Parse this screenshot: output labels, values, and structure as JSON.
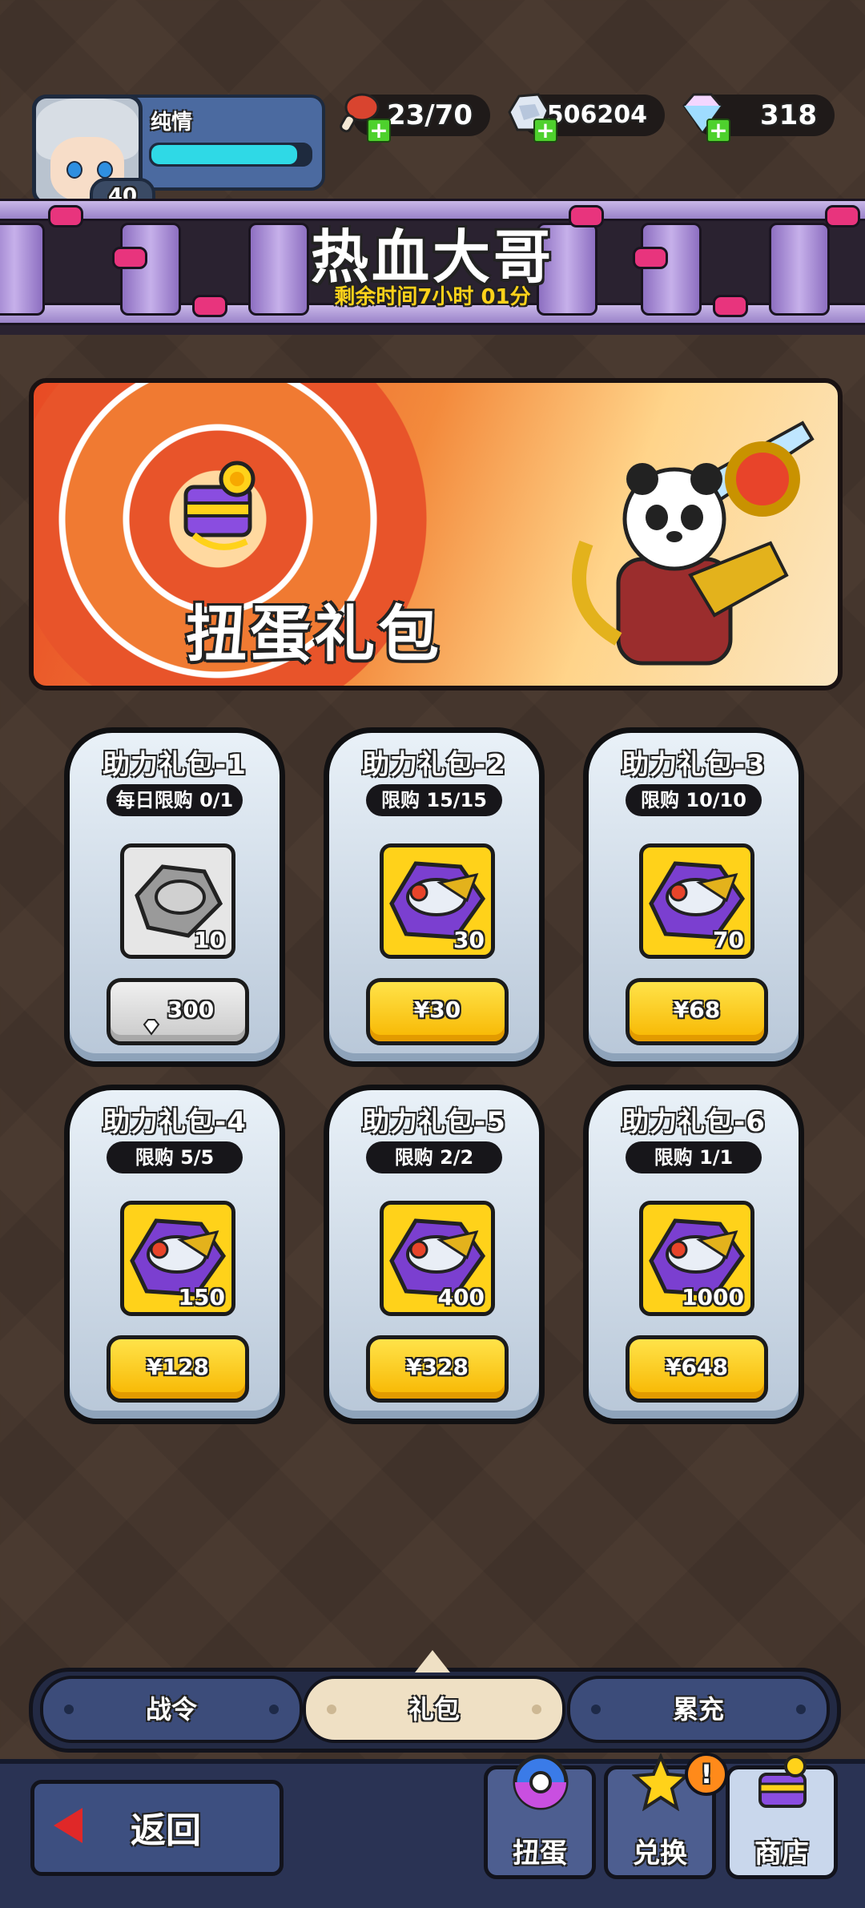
{
  "player": {
    "name": "纯情",
    "level": "40",
    "xp_fraction": 0.92
  },
  "resources": [
    {
      "icon": "meat-stamina-icon",
      "value": "23/70"
    },
    {
      "icon": "silver-coin-icon",
      "value": "506204"
    },
    {
      "icon": "diamond-gem-icon",
      "value": "318"
    }
  ],
  "event": {
    "title": "热血大哥",
    "timer": "剩余时间7小时 01分"
  },
  "hero": {
    "title": "扭蛋礼包",
    "icon": "capsule-gift-icon"
  },
  "packs": [
    {
      "title": "助力礼包-1",
      "limit": "每日限购 0/1",
      "qty": "10",
      "price": "300",
      "currency_icon": "diamond-icon",
      "gray": true
    },
    {
      "title": "助力礼包-2",
      "limit": "限购 15/15",
      "qty": "30",
      "price": "¥30",
      "gray": false
    },
    {
      "title": "助力礼包-3",
      "limit": "限购 10/10",
      "qty": "70",
      "price": "¥68",
      "gray": false
    },
    {
      "title": "助力礼包-4",
      "limit": "限购 5/5",
      "qty": "150",
      "price": "¥128",
      "gray": false
    },
    {
      "title": "助力礼包-5",
      "limit": "限购 2/2",
      "qty": "400",
      "price": "¥328",
      "gray": false
    },
    {
      "title": "助力礼包-6",
      "limit": "限购 1/1",
      "qty": "1000",
      "price": "¥648",
      "gray": false
    }
  ],
  "tabs": [
    {
      "label": "战令",
      "active": false
    },
    {
      "label": "礼包",
      "active": true
    },
    {
      "label": "累充",
      "active": false
    }
  ],
  "footer": {
    "back_label": "返回",
    "nav": [
      {
        "label": "扭蛋",
        "icon": "capsule-ball-icon"
      },
      {
        "label": "兑换",
        "icon": "star-exchange-icon",
        "alert": "!"
      },
      {
        "label": "商店",
        "icon": "shop-chest-icon"
      }
    ]
  },
  "colors": {
    "accent_yellow": "#ffd21a",
    "xp_cyan": "#2fd9e6",
    "plus_green": "#4ed12d",
    "alert_orange": "#ff8a1a"
  }
}
